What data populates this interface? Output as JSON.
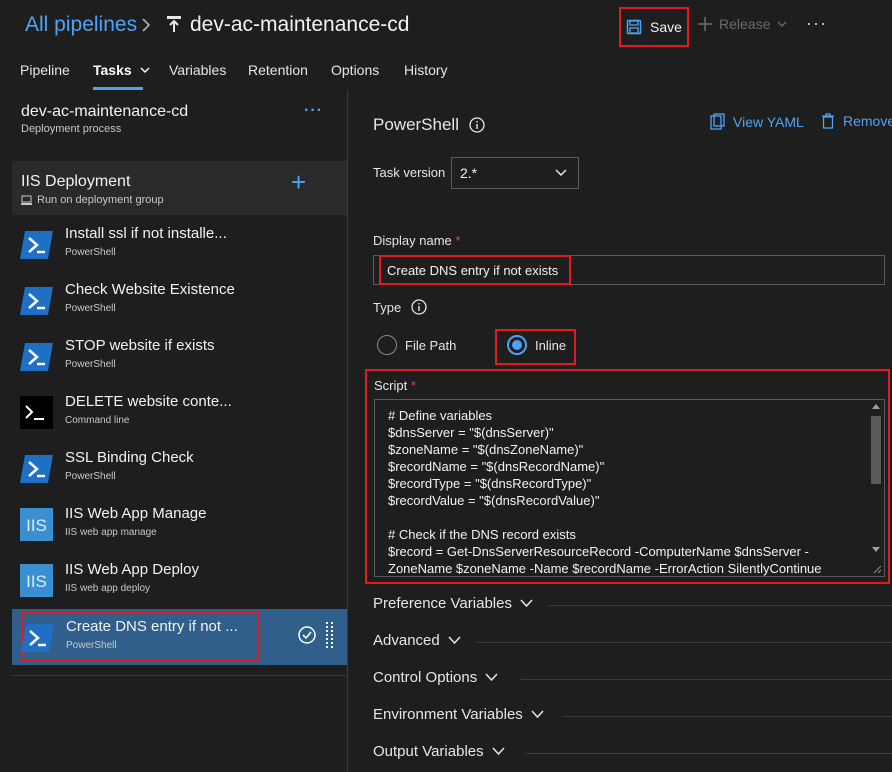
{
  "header": {
    "breadcrumb_root": "All pipelines",
    "pipeline_name": "dev-ac-maintenance-cd",
    "save_label": "Save",
    "release_label": "Release",
    "more_label": "···"
  },
  "tabs": [
    {
      "label": "Pipeline"
    },
    {
      "label": "Tasks"
    },
    {
      "label": "Variables"
    },
    {
      "label": "Retention"
    },
    {
      "label": "Options"
    },
    {
      "label": "History"
    }
  ],
  "process": {
    "title": "dev-ac-maintenance-cd",
    "subtitle": "Deployment process",
    "more_label": "···"
  },
  "phase": {
    "title": "IIS Deployment",
    "subtitle": "Run on deployment group",
    "add_label": "+"
  },
  "tasks": [
    {
      "name": "Install ssl if not installe...",
      "type": "PowerShell",
      "icon": "powershell-icon"
    },
    {
      "name": "Check Website Existence",
      "type": "PowerShell",
      "icon": "powershell-icon"
    },
    {
      "name": "STOP website if exists",
      "type": "PowerShell",
      "icon": "powershell-icon"
    },
    {
      "name": "DELETE website conte...",
      "type": "Command line",
      "icon": "command-line-icon"
    },
    {
      "name": "SSL Binding Check",
      "type": "PowerShell",
      "icon": "powershell-icon"
    },
    {
      "name": "IIS Web App Manage",
      "type": "IIS web app manage",
      "icon": "iis-icon"
    },
    {
      "name": "IIS Web App Deploy",
      "type": "IIS web app deploy",
      "icon": "iis-icon"
    },
    {
      "name": "Create DNS entry if not ...",
      "type": "PowerShell",
      "icon": "powershell-icon",
      "selected": true
    }
  ],
  "task_editor": {
    "title": "PowerShell",
    "view_yaml_label": "View YAML",
    "remove_label": "Remove",
    "task_version_label": "Task version",
    "task_version_value": "2.*",
    "display_name_label": "Display name",
    "required_mark": "*",
    "display_name_value": "Create DNS entry if not exists",
    "type_label": "Type",
    "type_options": [
      {
        "label": "File Path",
        "selected": false
      },
      {
        "label": "Inline",
        "selected": true
      }
    ],
    "script_label": "Script",
    "script_lines": [
      "# Define variables",
      "$dnsServer = \"$(dnsServer)\"",
      "$zoneName = \"$(dnsZoneName)\"",
      "$recordName = \"$(dnsRecordName)\"",
      "$recordType = \"$(dnsRecordType)\"",
      "$recordValue = \"$(dnsRecordValue)\"",
      "",
      "# Check if the DNS record exists",
      "$record = Get-DnsServerResourceRecord -ComputerName $dnsServer -",
      "ZoneName $zoneName -Name $recordName -ErrorAction SilentlyContinue"
    ],
    "sections": [
      {
        "label": "Preference Variables"
      },
      {
        "label": "Advanced"
      },
      {
        "label": "Control Options"
      },
      {
        "label": "Environment Variables"
      },
      {
        "label": "Output Variables"
      }
    ]
  },
  "colors": {
    "accent": "#4fa3f7",
    "highlight_outline": "#e01b24",
    "selected_task_bg": "#2f5f8a",
    "powershell_icon_bg": "#1f6fc5",
    "iis_icon_bg": "#3a8fd0"
  }
}
